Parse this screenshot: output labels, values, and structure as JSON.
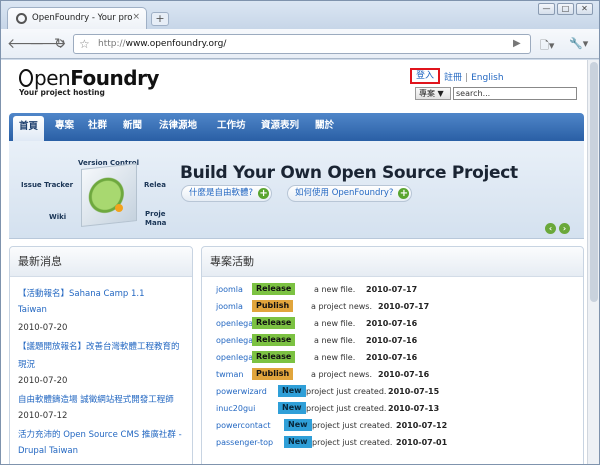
{
  "browser": {
    "tab_title": "OpenFoundry - Your proje···",
    "tab_close": "×",
    "new_tab": "+",
    "url_scheme": "http://",
    "url_host": "www.openfoundry.org/",
    "window_buttons": [
      "—",
      "□",
      "✕"
    ],
    "icons": [
      "back-icon",
      "forward-icon",
      "reload-icon",
      "star-icon",
      "go-icon",
      "page-menu-icon",
      "wrench-icon"
    ]
  },
  "header": {
    "logo_o": "",
    "logo_pen": "pen",
    "logo_foundry": "Foundry",
    "tagline": "Your project hosting",
    "login": "登入",
    "register": "註冊",
    "separator": "|",
    "english": "English",
    "search_scope": "專案",
    "search_scope_arrow": "▼",
    "search_placeholder": "search..."
  },
  "nav": {
    "items": [
      "首頁",
      "專案",
      "社群",
      "新聞",
      "法律源地",
      "工作坊",
      "資源表列",
      "關於"
    ]
  },
  "banner": {
    "labels": {
      "version_control": "Version Control",
      "issue_tracker": "Issue Tracker",
      "release": "Relea",
      "wiki": "Wiki",
      "project_manage_1": "Proje",
      "project_manage_2": "Mana"
    },
    "title": "Build Your Own Open Source Project",
    "pill_1": "什麼是自由軟體?",
    "pill_2": "如何使用 OpenFoundry?",
    "plus": "+",
    "prev": "‹",
    "next": "›"
  },
  "news": {
    "title": "最新消息",
    "items": [
      {
        "link": "【活動報名】Sahana Camp 1.1",
        "link2": "Taiwan",
        "date": "2010-07-20"
      },
      {
        "link": "【議題開放報名】改善台灣軟體工程教育的",
        "link2": "現況",
        "date": "2010-07-20"
      },
      {
        "link": "自由軟體鑄造場 誠徵網站程式開發工程師",
        "link2": "",
        "date": "2010-07-12"
      },
      {
        "link": "活力充沛的 Open Source CMS 推廣社群 -",
        "link2": "Drupal Taiwan",
        "date": ""
      }
    ]
  },
  "activity": {
    "title": "專案活動",
    "rows": [
      {
        "user": "joomla",
        "type": "Release",
        "kind": "release",
        "text": "a new file.",
        "date": "2010-07-17"
      },
      {
        "user": "joomla",
        "type": "Publish",
        "kind": "publish",
        "text": "a project news.",
        "date": "2010-07-17"
      },
      {
        "user": "openlegal",
        "type": "Release",
        "kind": "release",
        "text": "a new file.",
        "date": "2010-07-16"
      },
      {
        "user": "openlegal",
        "type": "Release",
        "kind": "release",
        "text": "a new file.",
        "date": "2010-07-16"
      },
      {
        "user": "openlegal",
        "type": "Release",
        "kind": "release",
        "text": "a new file.",
        "date": "2010-07-16"
      },
      {
        "user": "twman",
        "type": "Publish",
        "kind": "publish",
        "text": "a project news.",
        "date": "2010-07-16"
      },
      {
        "user": "powerwizard",
        "type": "New",
        "kind": "new",
        "text": "project just created.",
        "date": "2010-07-15"
      },
      {
        "user": "inuc20gui",
        "type": "New",
        "kind": "new",
        "text": "project just created.",
        "date": "2010-07-13"
      },
      {
        "user": "powercontact",
        "type": "New",
        "kind": "new",
        "text": "project just created.",
        "date": "2010-07-12"
      },
      {
        "user": "passenger-top",
        "type": "New",
        "kind": "new",
        "text": "project just created.",
        "date": "2010-07-01"
      }
    ]
  },
  "colors": {
    "nav_blue": "#2a5fa5",
    "release_green": "#7cc242",
    "publish_orange": "#e1a53c",
    "new_blue": "#2f9fd8",
    "link_blue": "#2468c2",
    "login_highlight": "#e0141c"
  }
}
